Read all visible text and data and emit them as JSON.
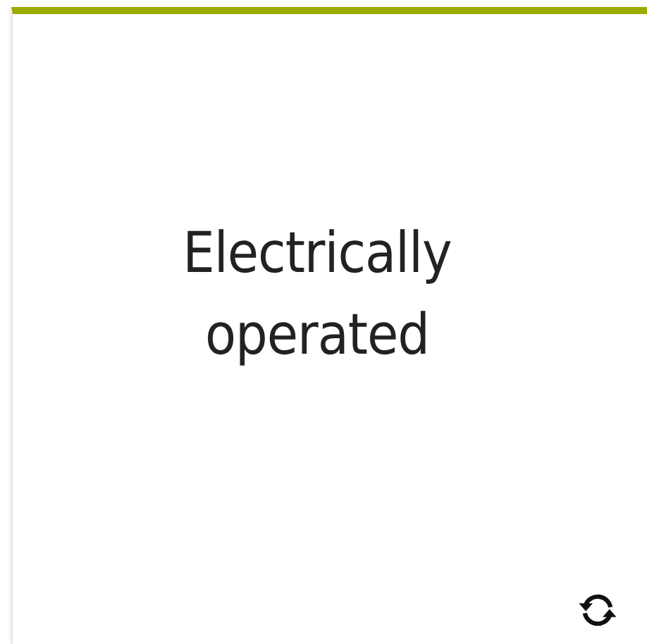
{
  "card": {
    "title": "Electrically operated"
  }
}
